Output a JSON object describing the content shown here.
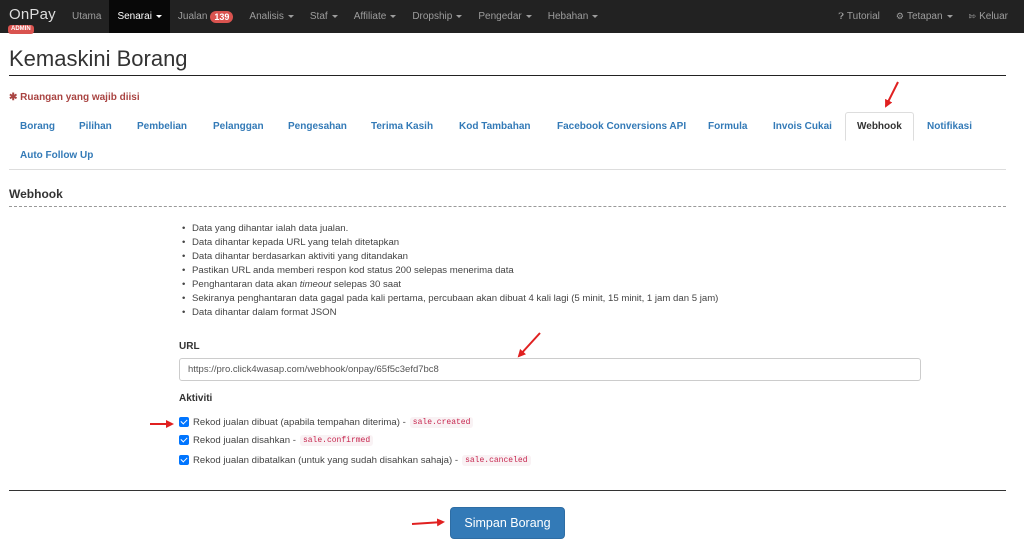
{
  "brand": {
    "name": "OnPay",
    "badge": "ADMIN"
  },
  "nav": {
    "items": [
      {
        "label": "Utama",
        "active": false,
        "caret": false
      },
      {
        "label": "Senarai",
        "active": true,
        "caret": true
      },
      {
        "label": "Jualan",
        "active": false,
        "caret": false,
        "badge": "139"
      },
      {
        "label": "Analisis",
        "active": false,
        "caret": true
      },
      {
        "label": "Staf",
        "active": false,
        "caret": true
      },
      {
        "label": "Affiliate",
        "active": false,
        "caret": true
      },
      {
        "label": "Dropship",
        "active": false,
        "caret": true
      },
      {
        "label": "Pengedar",
        "active": false,
        "caret": true
      },
      {
        "label": "Hebahan",
        "active": false,
        "caret": true
      }
    ],
    "right": {
      "tutorial": "Tutorial",
      "settings": "Tetapan",
      "logout": "Keluar"
    }
  },
  "page": {
    "title": "Kemaskini Borang",
    "required_note": "Ruangan yang wajib diisi"
  },
  "tabs": [
    {
      "label": "Borang",
      "active": false
    },
    {
      "label": "Pilihan",
      "active": false
    },
    {
      "label": "Pembelian",
      "active": false
    },
    {
      "label": "Pelanggan",
      "active": false
    },
    {
      "label": "Pengesahan",
      "active": false
    },
    {
      "label": "Terima Kasih",
      "active": false
    },
    {
      "label": "Kod Tambahan",
      "active": false
    },
    {
      "label": "Facebook Conversions API",
      "active": false
    },
    {
      "label": "Formula",
      "active": false
    },
    {
      "label": "Invois Cukai",
      "active": false
    },
    {
      "label": "Webhook",
      "active": true
    },
    {
      "label": "Notifikasi",
      "active": false
    },
    {
      "label": "Auto Follow Up",
      "active": false
    }
  ],
  "webhook": {
    "heading": "Webhook",
    "info": {
      "line1": "Data yang dihantar ialah data jualan.",
      "line2": "Data dihantar kepada URL yang telah ditetapkan",
      "line3": "Data dihantar berdasarkan aktiviti yang ditandakan",
      "line4": "Pastikan URL anda memberi respon kod status 200 selepas menerima data",
      "line5_pre": "Penghantaran data akan ",
      "line5_em": "timeout",
      "line5_post": " selepas 30 saat",
      "line6": "Sekiranya penghantaran data gagal pada kali pertama, percubaan akan dibuat 4 kali lagi (5 minit, 15 minit, 1 jam dan 5 jam)",
      "line7": "Data dihantar dalam format JSON"
    },
    "url_label": "URL",
    "url_value": "https://pro.click4wasap.com/webhook/onpay/65f5c3efd7bc8",
    "activity_label": "Aktiviti",
    "activities": [
      {
        "label": "Rekod jualan dibuat (apabila tempahan diterima) -",
        "code": "sale.created",
        "checked": true
      },
      {
        "label": "Rekod jualan disahkan -",
        "code": "sale.confirmed",
        "checked": true
      },
      {
        "label": "Rekod jualan dibatalkan (untuk yang sudah disahkan sahaja) -",
        "code": "sale.canceled",
        "checked": true
      }
    ]
  },
  "save_button": "Simpan Borang",
  "colors": {
    "navbar": "#222222",
    "link": "#337ab7",
    "danger": "#d9534f",
    "arrow": "#e02020"
  }
}
